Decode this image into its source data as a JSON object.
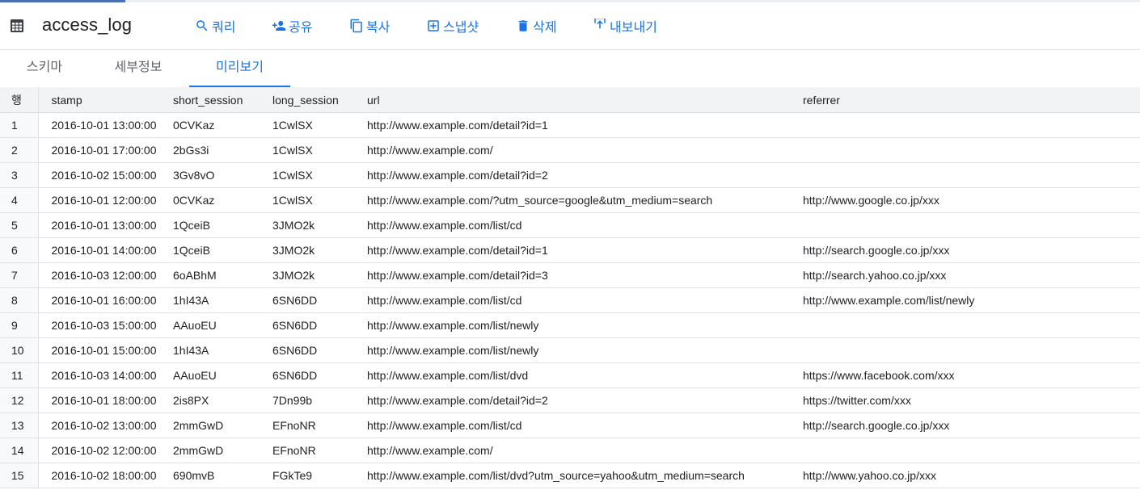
{
  "header": {
    "title": "access_log",
    "actions": [
      {
        "icon": "search-icon",
        "label": "쿼리"
      },
      {
        "icon": "person-add-icon",
        "label": "공유"
      },
      {
        "icon": "copy-icon",
        "label": "복사"
      },
      {
        "icon": "snapshot-icon",
        "label": "스냅샷"
      },
      {
        "icon": "trash-icon",
        "label": "삭제"
      },
      {
        "icon": "export-icon",
        "label": "내보내기"
      }
    ]
  },
  "tabs": [
    {
      "label": "스키마",
      "active": false
    },
    {
      "label": "세부정보",
      "active": false
    },
    {
      "label": "미리보기",
      "active": true
    }
  ],
  "table": {
    "columns": [
      "행",
      "stamp",
      "short_session",
      "long_session",
      "url",
      "referrer"
    ],
    "rows": [
      [
        "1",
        "2016-10-01 13:00:00",
        "0CVKaz",
        "1CwlSX",
        "http://www.example.com/detail?id=1",
        ""
      ],
      [
        "2",
        "2016-10-01 17:00:00",
        "2bGs3i",
        "1CwlSX",
        "http://www.example.com/",
        ""
      ],
      [
        "3",
        "2016-10-02 15:00:00",
        "3Gv8vO",
        "1CwlSX",
        "http://www.example.com/detail?id=2",
        ""
      ],
      [
        "4",
        "2016-10-01 12:00:00",
        "0CVKaz",
        "1CwlSX",
        "http://www.example.com/?utm_source=google&utm_medium=search",
        "http://www.google.co.jp/xxx"
      ],
      [
        "5",
        "2016-10-01 13:00:00",
        "1QceiB",
        "3JMO2k",
        "http://www.example.com/list/cd",
        ""
      ],
      [
        "6",
        "2016-10-01 14:00:00",
        "1QceiB",
        "3JMO2k",
        "http://www.example.com/detail?id=1",
        "http://search.google.co.jp/xxx"
      ],
      [
        "7",
        "2016-10-03 12:00:00",
        "6oABhM",
        "3JMO2k",
        "http://www.example.com/detail?id=3",
        "http://search.yahoo.co.jp/xxx"
      ],
      [
        "8",
        "2016-10-01 16:00:00",
        "1hI43A",
        "6SN6DD",
        "http://www.example.com/list/cd",
        "http://www.example.com/list/newly"
      ],
      [
        "9",
        "2016-10-03 15:00:00",
        "AAuoEU",
        "6SN6DD",
        "http://www.example.com/list/newly",
        ""
      ],
      [
        "10",
        "2016-10-01 15:00:00",
        "1hI43A",
        "6SN6DD",
        "http://www.example.com/list/newly",
        ""
      ],
      [
        "11",
        "2016-10-03 14:00:00",
        "AAuoEU",
        "6SN6DD",
        "http://www.example.com/list/dvd",
        "https://www.facebook.com/xxx"
      ],
      [
        "12",
        "2016-10-01 18:00:00",
        "2is8PX",
        "7Dn99b",
        "http://www.example.com/detail?id=2",
        "https://twitter.com/xxx"
      ],
      [
        "13",
        "2016-10-02 13:00:00",
        "2mmGwD",
        "EFnoNR",
        "http://www.example.com/list/cd",
        "http://search.google.co.jp/xxx"
      ],
      [
        "14",
        "2016-10-02 12:00:00",
        "2mmGwD",
        "EFnoNR",
        "http://www.example.com/",
        ""
      ],
      [
        "15",
        "2016-10-02 18:00:00",
        "690mvB",
        "FGkTe9",
        "http://www.example.com/list/dvd?utm_source=yahoo&utm_medium=search",
        "http://www.yahoo.co.jp/xxx"
      ]
    ]
  },
  "colors": {
    "accent": "#1a73e8",
    "header_bg": "#f1f3f4"
  }
}
